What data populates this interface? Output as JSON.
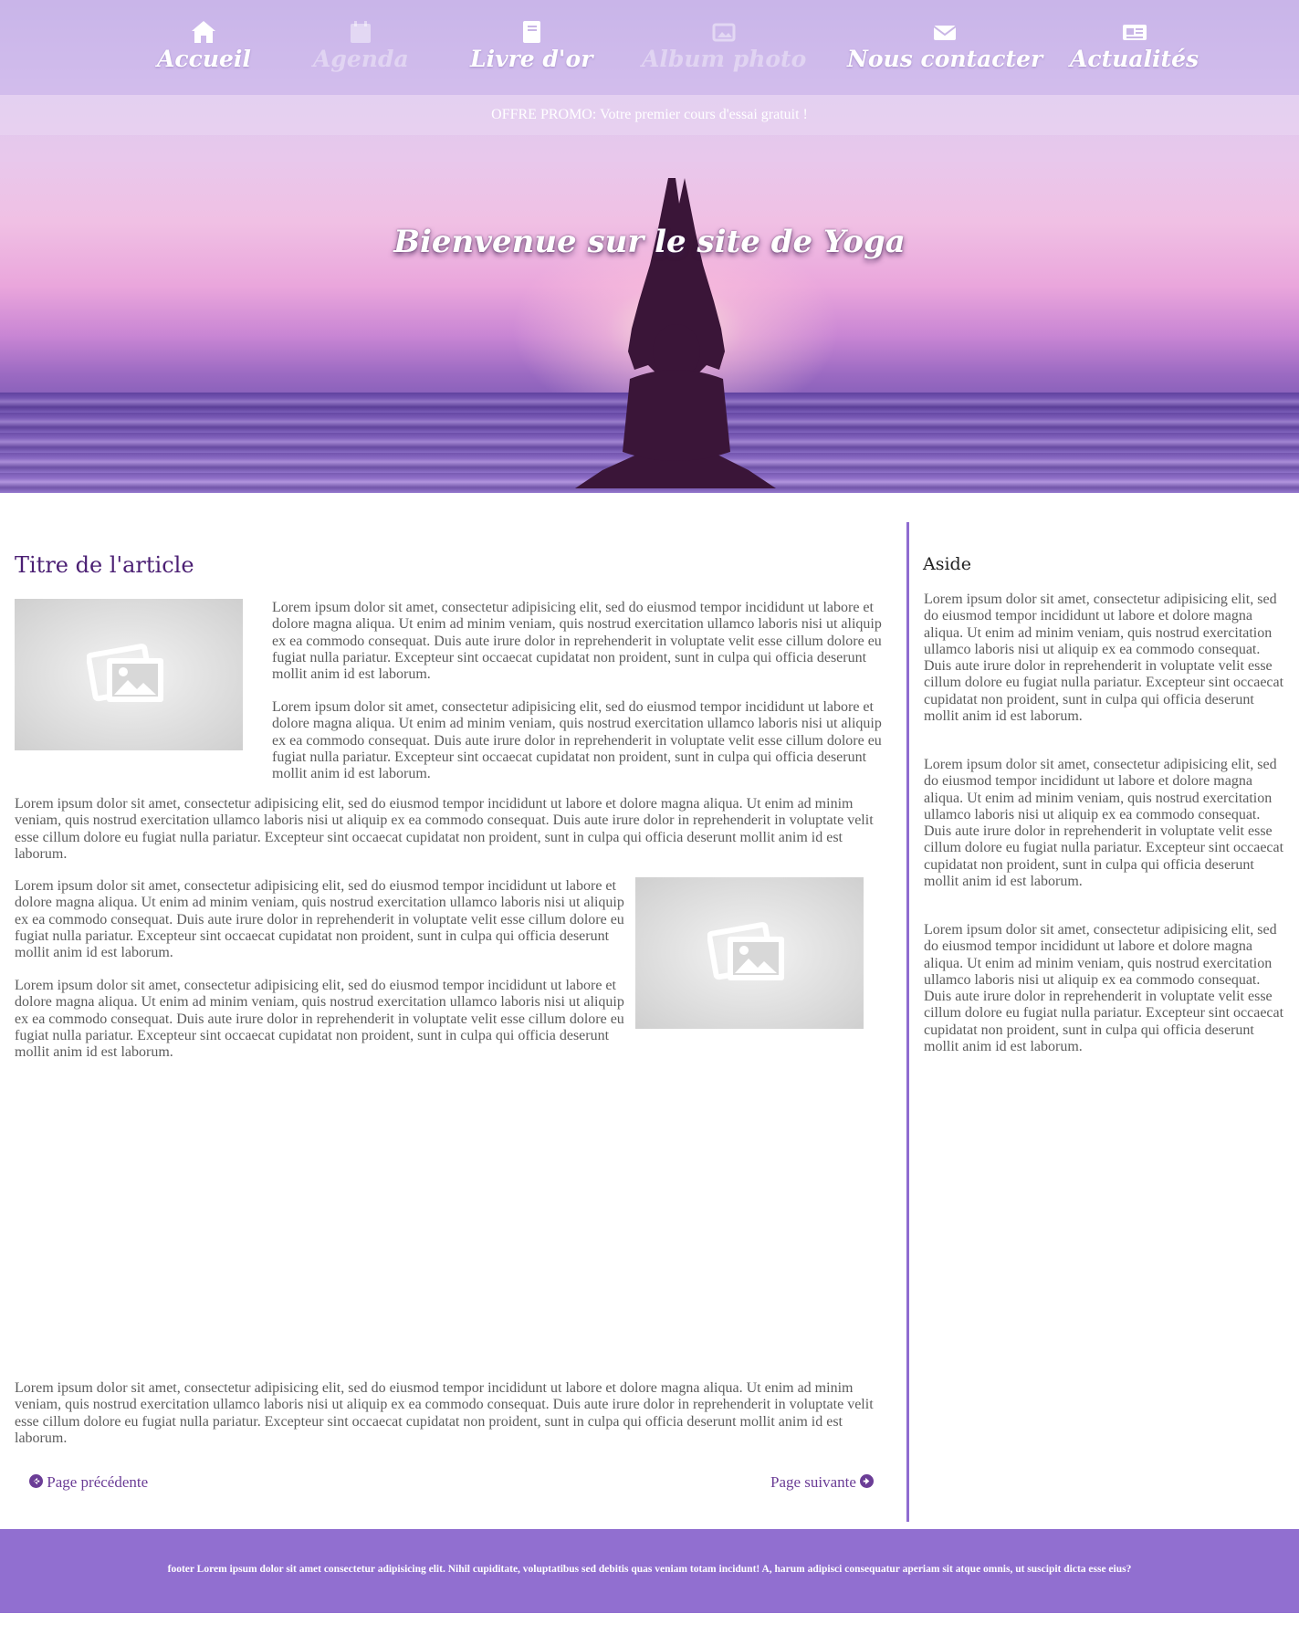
{
  "nav": {
    "items": [
      {
        "label": "Accueil",
        "icon": "home-icon",
        "active": true
      },
      {
        "label": "Agenda",
        "icon": "calendar-icon",
        "active": false
      },
      {
        "label": "Livre d'or",
        "icon": "book-icon",
        "active": true
      },
      {
        "label": "Album photo",
        "icon": "images-icon",
        "active": false
      },
      {
        "label": "Nous contacter",
        "icon": "envelope-icon",
        "active": true
      },
      {
        "label": "Actualités",
        "icon": "newspaper-icon",
        "active": true
      }
    ]
  },
  "promo": "OFFRE PROMO: Votre premier cours d'essai gratuit !",
  "hero": {
    "title": "Bienvenue sur le site de Yoga"
  },
  "article": {
    "title": "Titre de l'article",
    "lorem": "Lorem ipsum dolor sit amet, consectetur adipisicing elit, sed do eiusmod tempor incididunt ut labore et dolore magna aliqua. Ut enim ad minim veniam, quis nostrud exercitation ullamco laboris nisi ut aliquip ex ea commodo consequat. Duis aute irure dolor in reprehenderit in voluptate velit esse cillum dolore eu fugiat nulla pariatur. Excepteur sint occaecat cupidatat non proident, sunt in culpa qui officia deserunt mollit anim id est laborum.",
    "prev": "Page précédente",
    "next": "Page suivante"
  },
  "aside": {
    "title": "Aside",
    "lorem": "Lorem ipsum dolor sit amet, consectetur adipisicing elit, sed do eiusmod tempor incididunt ut labore et dolore magna aliqua. Ut enim ad minim veniam, quis nostrud exercitation ullamco laboris nisi ut aliquip ex ea commodo consequat. Duis aute irure dolor in reprehenderit in voluptate velit esse cillum dolore eu fugiat nulla pariatur. Excepteur sint occaecat cupidatat non proident, sunt in culpa qui officia deserunt mollit anim id est laborum."
  },
  "footer": "footer Lorem ipsum dolor sit amet consectetur adipisicing elit. Nihil cupiditate, voluptatibus sed debitis quas veniam totam incidunt! A, harum adipisci consequatur aperiam sit atque omnis, ut suscipit dicta esse eius?",
  "colors": {
    "accent": "#916fd0",
    "title": "#4b1f73",
    "link": "#6b3d96"
  }
}
